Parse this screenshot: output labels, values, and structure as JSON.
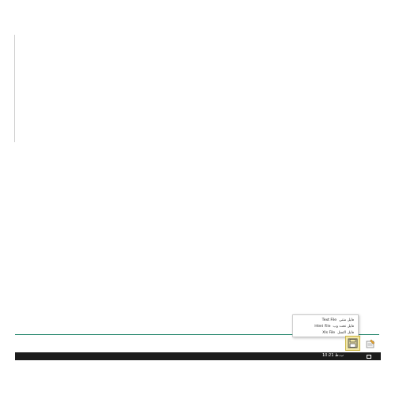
{
  "export_menu": {
    "items": [
      {
        "arabic": "فايل متنى",
        "english": "Text File"
      },
      {
        "arabic": "فايل تحت وب",
        "english": "Html File"
      },
      {
        "arabic": "فايل اكسل",
        "english": "Xls File"
      }
    ]
  },
  "toolbar": {
    "save_icon": "floppy-disk-icon",
    "edit_icon": "document-edit-icon"
  },
  "taskbar": {
    "clock": "10:21 ب.ظ"
  },
  "colors": {
    "accent_line": "#2e8b72",
    "save_highlight": "#f3e8a6",
    "taskbar": "#1c1c1c"
  }
}
